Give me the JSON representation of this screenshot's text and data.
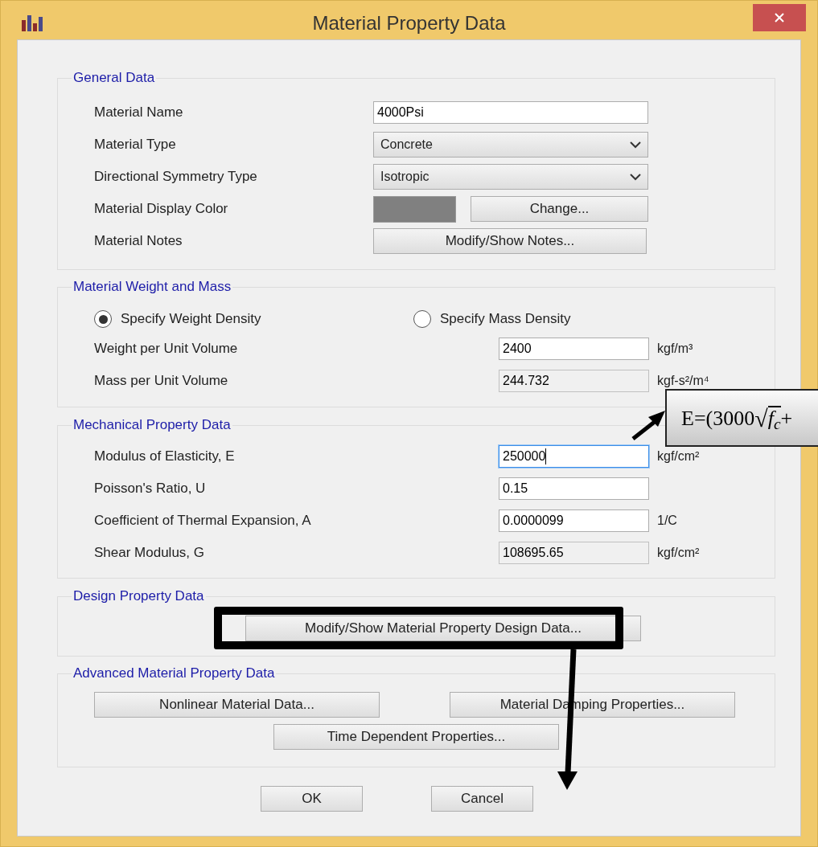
{
  "window": {
    "title": "Material Property Data"
  },
  "general": {
    "title": "General Data",
    "rows": [
      {
        "kind": "text",
        "label": "Material Name",
        "value": "4000Psi"
      },
      {
        "kind": "select",
        "label": "Material Type",
        "value": "Concrete"
      },
      {
        "kind": "select",
        "label": "Directional Symmetry Type",
        "value": "Isotropic"
      },
      {
        "kind": "color",
        "label": "Material Display Color",
        "color": "#808080",
        "button": "Change..."
      },
      {
        "kind": "button",
        "label": "Material Notes",
        "button": "Modify/Show Notes..."
      }
    ]
  },
  "weight": {
    "title": "Material Weight and Mass",
    "radios": [
      {
        "label": "Specify Weight Density",
        "selected": true
      },
      {
        "label": "Specify Mass Density",
        "selected": false
      }
    ],
    "rows": [
      {
        "label": "Weight per Unit Volume",
        "value": "2400",
        "unit": "kgf/m³",
        "disabled": false,
        "focused": false
      },
      {
        "label": "Mass per Unit Volume",
        "value": "244.732",
        "unit": "kgf-s²/m⁴",
        "disabled": true,
        "focused": false
      }
    ]
  },
  "mechanical": {
    "title": "Mechanical Property Data",
    "rows": [
      {
        "label": "Modulus of Elasticity,  E",
        "value": "250000",
        "unit": "kgf/cm²",
        "disabled": false,
        "focused": true
      },
      {
        "label": "Poisson's Ratio,  U",
        "value": "0.15",
        "disabled": false,
        "focused": false
      },
      {
        "label": "Coefficient of Thermal Expansion,  A",
        "value": "0.0000099",
        "unit": "1/C",
        "disabled": false,
        "focused": false
      },
      {
        "label": "Shear Modulus,  G",
        "value": "108695.65",
        "unit": "kgf/cm²",
        "disabled": true,
        "focused": false
      }
    ]
  },
  "design": {
    "title": "Design Property Data",
    "button": "Modify/Show Material Property Design Data..."
  },
  "advanced": {
    "title": "Advanced Material Property Data",
    "buttons": [
      "Nonlinear Material Data...",
      "Material Damping Properties...",
      "Time Dependent Properties..."
    ]
  },
  "footer_buttons": [
    "OK",
    "Cancel"
  ],
  "callout": {
    "prefix": "E=(3000",
    "radical": "√",
    "radicand": "f$_{c}$",
    "suffix": "+"
  }
}
